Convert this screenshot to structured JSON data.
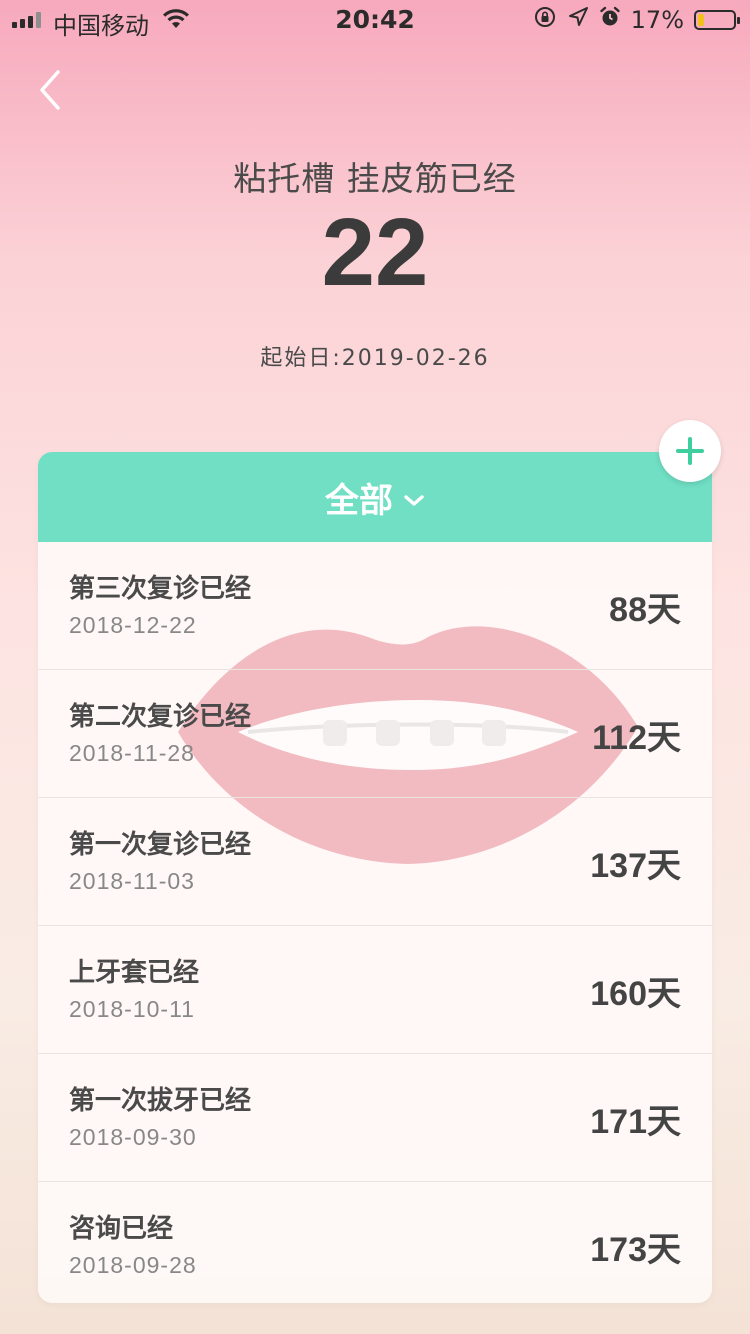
{
  "status_bar": {
    "carrier": "中国移动",
    "time": "20:42",
    "battery_percent": "17%",
    "battery_level": 0.17,
    "battery_color": "#f2c21a"
  },
  "header": {
    "title": "粘托槽 挂皮筋已经",
    "count": "22",
    "start_date": "起始日:2019-02-26"
  },
  "filter": {
    "label": "全部",
    "accent_color": "#70dfc4"
  },
  "records": [
    {
      "title": "第三次复诊已经",
      "date": "2018-12-22",
      "days": "88天"
    },
    {
      "title": "第二次复诊已经",
      "date": "2018-11-28",
      "days": "112天"
    },
    {
      "title": "第一次复诊已经",
      "date": "2018-11-03",
      "days": "137天"
    },
    {
      "title": "上牙套已经",
      "date": "2018-10-11",
      "days": "160天"
    },
    {
      "title": "第一次拔牙已经",
      "date": "2018-09-30",
      "days": "171天"
    },
    {
      "title": "咨询已经",
      "date": "2018-09-28",
      "days": "173天"
    }
  ],
  "icons": {
    "back": "chevron-left-icon",
    "add": "plus-icon",
    "filter": "chevron-down-icon",
    "background": "lips-illustration"
  }
}
